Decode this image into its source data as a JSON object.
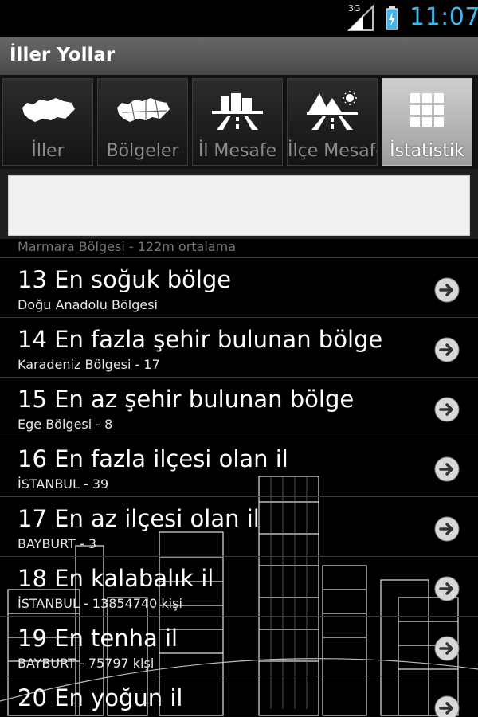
{
  "status_bar": {
    "network": "3G",
    "time": "11:07",
    "accent": "#3fb7ea"
  },
  "app": {
    "title": "İller Yollar"
  },
  "tabs": [
    {
      "label": "İller",
      "icon": "turkey-map-icon",
      "active": false
    },
    {
      "label": "Bölgeler",
      "icon": "regions-map-icon",
      "active": false
    },
    {
      "label": "İl Mesafe",
      "icon": "city-road-icon",
      "active": false
    },
    {
      "label": "İlçe Mesafe",
      "icon": "mountain-road-icon",
      "active": false
    },
    {
      "label": "İstatistik",
      "icon": "grid-icon",
      "active": true
    }
  ],
  "search": {
    "value": "",
    "placeholder": ""
  },
  "list": {
    "partial_item": "Marmara Bölgesi - 122m ortalama",
    "items": [
      {
        "title": "13 En soğuk bölge",
        "subtitle": "Doğu Anadolu Bölgesi"
      },
      {
        "title": "14 En fazla şehir bulunan bölge",
        "subtitle": "Karadeniz Bölgesi - 17"
      },
      {
        "title": "15 En az şehir bulunan bölge",
        "subtitle": "Ege Bölgesi - 8"
      },
      {
        "title": "16 En fazla ilçesi olan il",
        "subtitle": "İSTANBUL - 39"
      },
      {
        "title": "17 En az ilçesi olan il",
        "subtitle": "BAYBURT - 3"
      },
      {
        "title": "18 En kalabalık il",
        "subtitle": "İSTANBUL - 13854740 kişi"
      },
      {
        "title": "19 En tenha il",
        "subtitle": "BAYBURT - 75797 kişi"
      },
      {
        "title": "20 En yoğun il",
        "subtitle": ""
      }
    ]
  }
}
